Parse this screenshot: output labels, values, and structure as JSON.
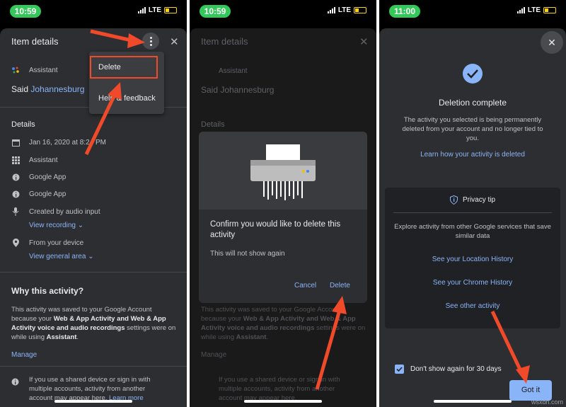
{
  "status": {
    "p1_time": "10:59",
    "p2_time": "10:59",
    "p3_time": "11:00",
    "network": "LTE"
  },
  "p1": {
    "title": "Item details",
    "source": "Assistant",
    "said_prefix": "Said",
    "said_link": "Johannesburg",
    "details_heading": "Details",
    "date": "Jan 16, 2020 at 8:24 PM",
    "product": "Assistant",
    "app1": "Google App",
    "app2": "Google App",
    "input": "Created by audio input",
    "view_recording": "View recording",
    "device": "From your device",
    "view_area": "View general area",
    "why_heading": "Why this activity?",
    "why_text_1": "This activity was saved to your Google Account because your",
    "why_bold_1": "Web & App Activity and Web & App Activity voice and audio recordings",
    "why_text_2": "settings were on while using",
    "why_bold_2": "Assistant",
    "why_end": ".",
    "manage": "Manage",
    "shared_text": "If you use a shared device or sign in with multiple accounts, activity from another account may appear here.",
    "learn_more": "Learn more",
    "menu_delete": "Delete",
    "menu_help": "Help & feedback"
  },
  "p2": {
    "dialog_title": "Confirm you would like to delete this activity",
    "dialog_sub": "This will not show again",
    "cancel": "Cancel",
    "delete": "Delete"
  },
  "p3": {
    "heading": "Deletion complete",
    "body": "The activity you selected is being permanently deleted from your account and no longer tied to you.",
    "learn_link": "Learn how your activity is deleted",
    "tip_title": "Privacy tip",
    "tip_body": "Explore activity from other Google services that save similar data",
    "link_location": "See your Location History",
    "link_chrome": "See your Chrome History",
    "link_other": "See other activity",
    "checkbox_label": "Don't show again for 30 days",
    "got_it": "Got it"
  },
  "watermark": "wsxdn.com",
  "colors": {
    "accent": "#8ab4f8",
    "arrow": "#f04a2a",
    "sheet": "#2d2e31",
    "status_pill": "#34c759"
  }
}
